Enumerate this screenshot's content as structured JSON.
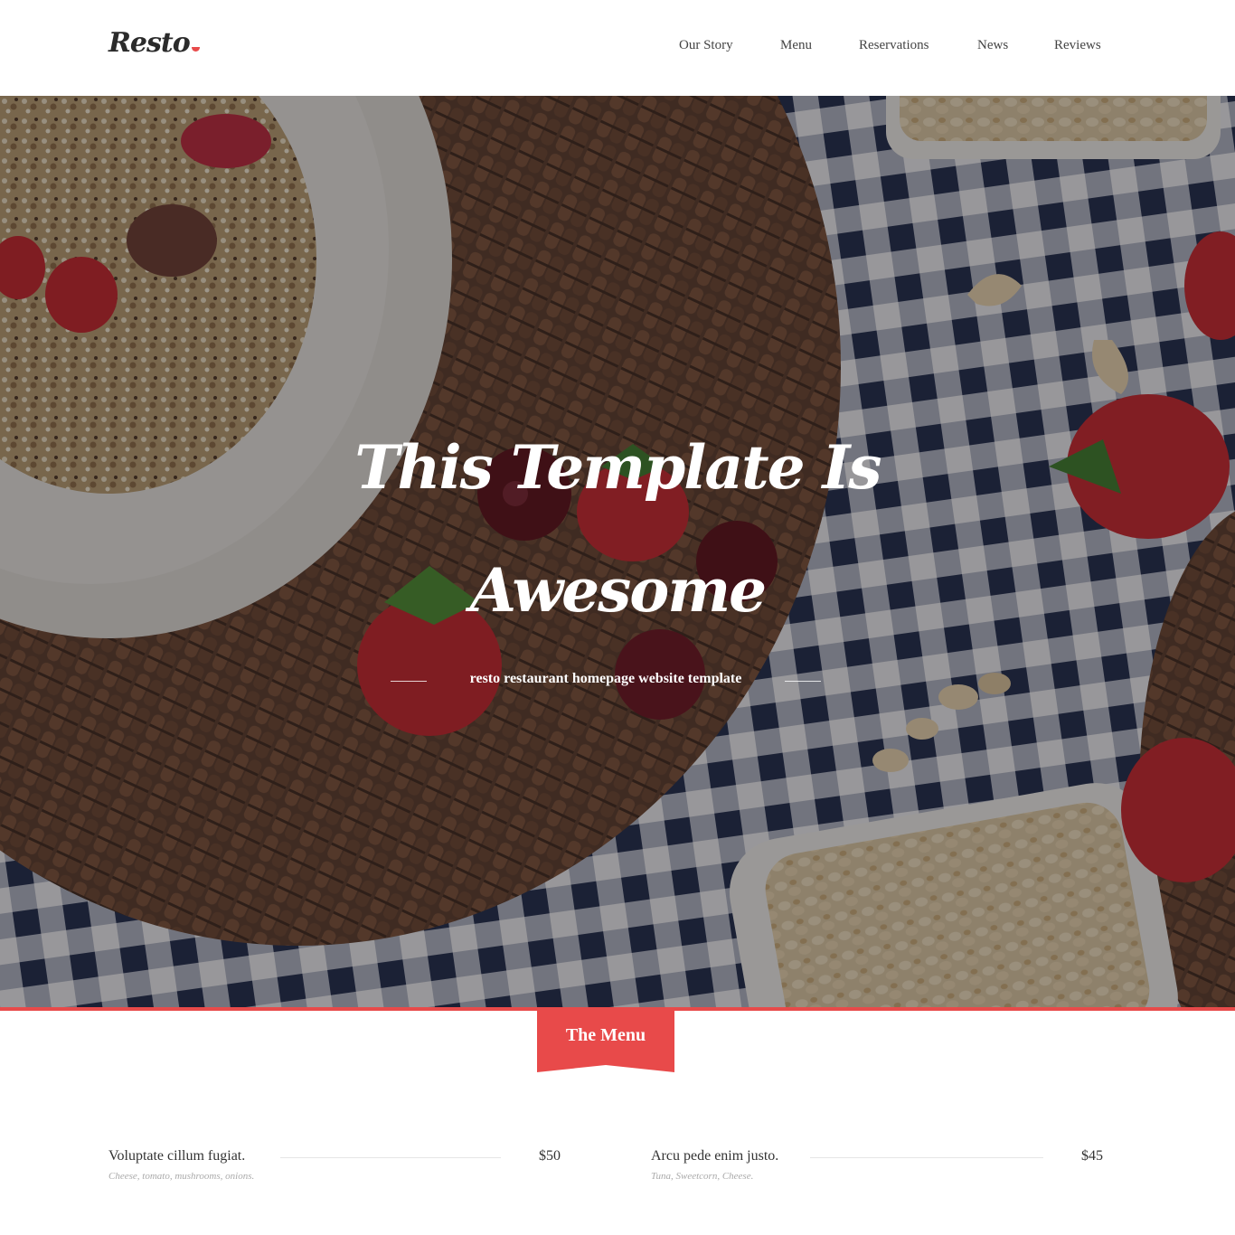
{
  "brand": {
    "logo": "Resto",
    "accent_color": "#e84a4a"
  },
  "nav": {
    "items": [
      {
        "label": "Our Story"
      },
      {
        "label": "Menu"
      },
      {
        "label": "Reservations"
      },
      {
        "label": "News"
      },
      {
        "label": "Reviews"
      }
    ]
  },
  "hero": {
    "title_line1": "This Template Is",
    "title_line2": "Awesome",
    "subtitle": "resto restaurant homepage website template"
  },
  "menu_section": {
    "title": "The Menu",
    "items": [
      {
        "name": "Voluptate cillum fugiat.",
        "price": "$50",
        "description": "Cheese, tomato, mushrooms, onions."
      },
      {
        "name": "Arcu pede enim justo.",
        "price": "$45",
        "description": "Tuna, Sweetcorn, Cheese."
      }
    ]
  }
}
